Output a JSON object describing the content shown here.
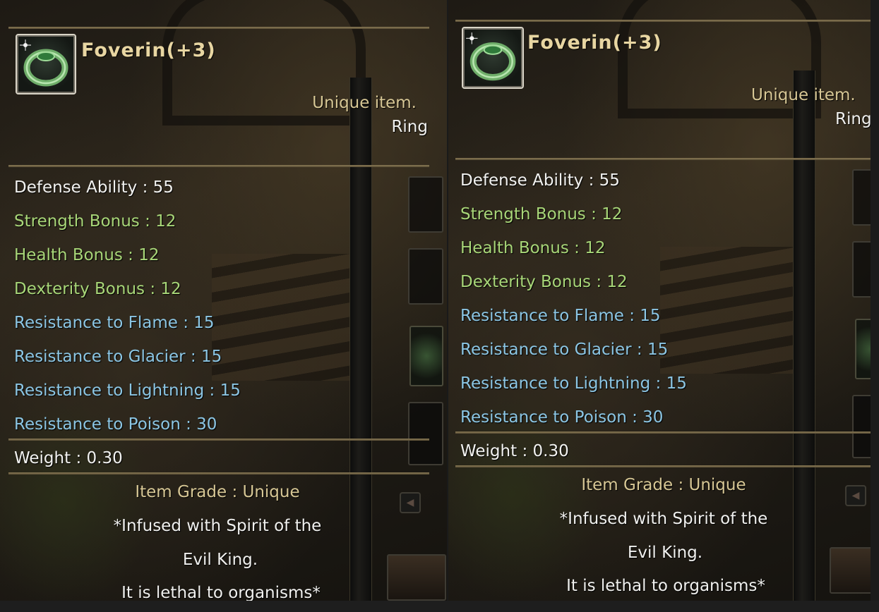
{
  "tooltips": [
    {
      "item_name": "Foverin(+3)",
      "icon": "jade-ring-icon",
      "rarity_label": "Unique item.",
      "item_type": "Ring",
      "stats": [
        {
          "text": "Defense Ability : 55",
          "color": "#f2f2f0"
        },
        {
          "text": "Strength Bonus : 12",
          "color": "#a8d678"
        },
        {
          "text": "Health Bonus : 12",
          "color": "#a8d678"
        },
        {
          "text": "Dexterity Bonus : 12",
          "color": "#a8d678"
        },
        {
          "text": "Resistance to Flame : 15",
          "color": "#8cc6e4"
        },
        {
          "text": "Resistance to Glacier : 15",
          "color": "#8cc6e4"
        },
        {
          "text": "Resistance to Lightning : 15",
          "color": "#8cc6e4"
        },
        {
          "text": "Resistance to Poison : 30",
          "color": "#8cc6e4"
        }
      ],
      "weight": "Weight : 0.30",
      "grade": "Item Grade : Unique",
      "description": [
        "*Infused with Spirit of the",
        "Evil King.",
        "It is lethal to organisms*"
      ]
    },
    {
      "item_name": "Foverin(+3)",
      "icon": "jade-ring-icon",
      "rarity_label": "Unique item.",
      "item_type": "Ring",
      "stats": [
        {
          "text": "Defense Ability : 55",
          "color": "#f2f2f0"
        },
        {
          "text": "Strength Bonus : 12",
          "color": "#a8d678"
        },
        {
          "text": "Health Bonus : 12",
          "color": "#a8d678"
        },
        {
          "text": "Dexterity Bonus : 12",
          "color": "#a8d678"
        },
        {
          "text": "Resistance to Flame : 15",
          "color": "#8cc6e4"
        },
        {
          "text": "Resistance to Glacier : 15",
          "color": "#8cc6e4"
        },
        {
          "text": "Resistance to Lightning : 15",
          "color": "#8cc6e4"
        },
        {
          "text": "Resistance to Poison : 30",
          "color": "#8cc6e4"
        }
      ],
      "weight": "Weight : 0.30",
      "grade": "Item Grade : Unique",
      "description": [
        "*Infused with Spirit of the",
        "Evil King.",
        "It is lethal to organisms*"
      ]
    }
  ]
}
